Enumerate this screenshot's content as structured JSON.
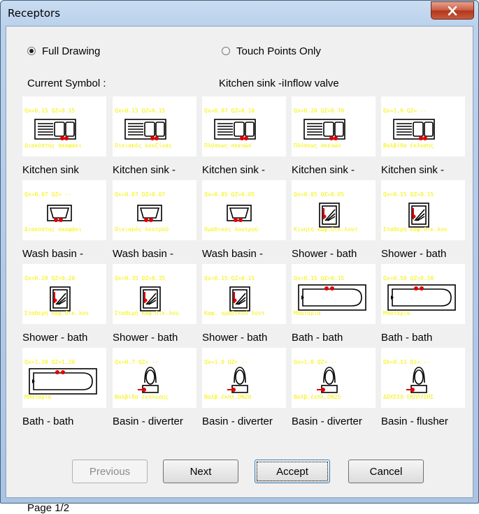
{
  "window": {
    "title": "Receptors",
    "close_icon": "close-x-icon"
  },
  "options": {
    "full_drawing": "Full Drawing",
    "touch_points": "Touch Points Only",
    "selected": "full_drawing"
  },
  "current_symbol": {
    "label": "Current Symbol :",
    "value": "Kitchen sink -iInflow valve"
  },
  "items": [
    {
      "top": "Qx=0.15 QZ=0.15",
      "bottom": "Διακόπτης σκαφάκι",
      "caption": "Kitchen sink",
      "kind": "sink"
    },
    {
      "top": "Qx=0.15 QZ=0.15",
      "bottom": "Οικιακός κουζίνας",
      "caption": "Kitchen sink -",
      "kind": "sink"
    },
    {
      "top": "Qx=0.07 QZ=0.10",
      "bottom": "Πλύσεως σκευών",
      "caption": "Kitchen sink -",
      "kind": "sink"
    },
    {
      "top": "Qx=0.20 QZ=0.70",
      "bottom": "Πλύσεως σκευών",
      "caption": "Kitchen sink -",
      "kind": "sink"
    },
    {
      "top": "Qx=1.0 QZ= --",
      "bottom": "Βαλβίδα έκλυσης",
      "caption": "Kitchen sink -",
      "kind": "sink"
    },
    {
      "top": "Qx=0.07 QZ= --",
      "bottom": "Διακόπτης σκαφάκι",
      "caption": "Wash basin -",
      "kind": "basin"
    },
    {
      "top": "Qx=0.07 QZ=0.07",
      "bottom": "Οικιακός λουτρού",
      "caption": "Wash basin -",
      "kind": "basin"
    },
    {
      "top": "Qx=0.05 QZ=0.05",
      "bottom": "Ομαδικός λουτρού",
      "caption": "Wash basin -",
      "kind": "basin"
    },
    {
      "top": "Qx=0.05 QZ=0.05",
      "bottom": "Κινητή καφ.Οικ.λουτ",
      "caption": "Shower - bath",
      "kind": "shower"
    },
    {
      "top": "Qx=0.15 QZ=0.15",
      "bottom": "Σταθερή καφ.Οικ.λου",
      "caption": "Shower - bath",
      "kind": "shower"
    },
    {
      "top": "Qx=0.20 QZ=0.20",
      "bottom": "Σταθερή καφ.Οικ.λου",
      "caption": "Shower - bath",
      "kind": "shower"
    },
    {
      "top": "Qx=0.35 QZ=0.35",
      "bottom": "Σταθερή καφ.Οικ.λου",
      "caption": "Shower - bath",
      "kind": "shower"
    },
    {
      "top": "Qx=0.15 QZ=0.15",
      "bottom": "Καφ. ομαδικού λουτ",
      "caption": "Shower - bath",
      "kind": "shower"
    },
    {
      "top": "Qx=0.15 QZ=0.15",
      "bottom": "Μπαταρία",
      "caption": "Bath - bath",
      "kind": "bath"
    },
    {
      "top": "Qx=0.50 QZ=0.50",
      "bottom": "Μπαταρία",
      "caption": "Bath - bath",
      "kind": "bath"
    },
    {
      "top": "Qx=1.20 QZ=1.20",
      "bottom": "Μπαταρία",
      "caption": "Bath - bath",
      "kind": "bath"
    },
    {
      "top": "Qx=0.7 QZ= --",
      "bottom": "Βαλβίδα έκπλυσης",
      "caption": "Basin - diverter",
      "kind": "wc"
    },
    {
      "top": "Qx=1.0 QZ= --",
      "bottom": "Βαλβ.έκπλ.DN20",
      "caption": "Basin - diverter",
      "kind": "wc"
    },
    {
      "top": "Qx=1.0 QZ= --",
      "bottom": "Βαλβ.έκπλ.DN25",
      "caption": "Basin - diverter",
      "kind": "wc"
    },
    {
      "top": "Qk=0.13 Qz= --",
      "bottom": "ΔΟΧΕΙΟ ΕΚΠΛΥΣΗΣ",
      "caption": "Basin - flusher",
      "kind": "wc"
    }
  ],
  "buttons": {
    "previous": "Previous",
    "next": "Next",
    "accept": "Accept",
    "cancel": "Cancel"
  },
  "page_info": "Page 1/2",
  "colors": {
    "label_yellow": "#f6f100",
    "symbol_red": "#e00000"
  }
}
